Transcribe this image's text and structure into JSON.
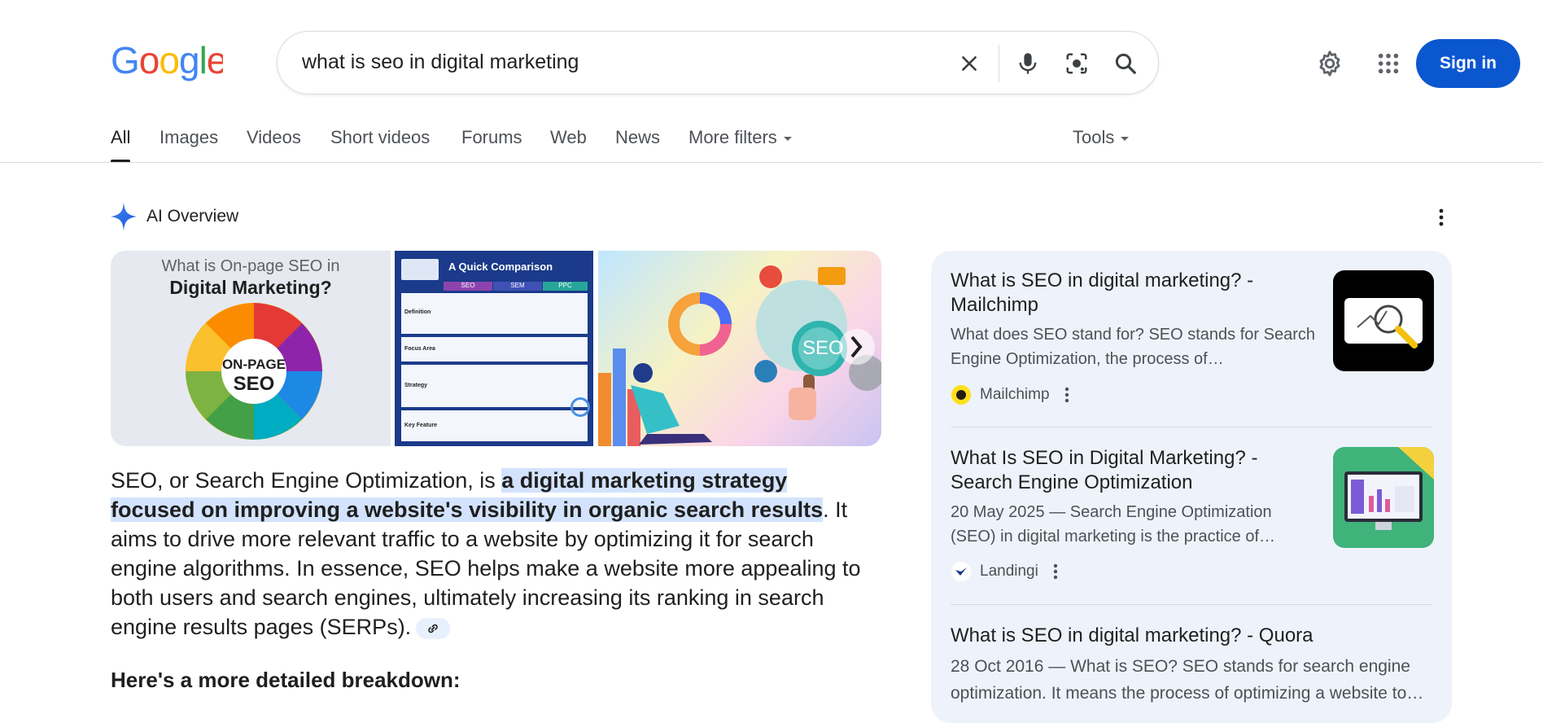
{
  "search": {
    "query": "what is seo in digital marketing"
  },
  "header": {
    "sign_in_label": "Sign in"
  },
  "tabs": [
    "All",
    "Images",
    "Videos",
    "Short videos",
    "Forums",
    "Web",
    "News",
    "More filters"
  ],
  "tools_label": "Tools",
  "ai_overview": {
    "title": "AI Overview",
    "images": {
      "img1_line1": "What is On-page SEO in",
      "img1_line2": "Digital Marketing?",
      "img1_center_1": "ON-PAGE",
      "img1_center_2": "SEO",
      "img2_title": "A Quick Comparison",
      "img2_cols": [
        "SEO",
        "SEM",
        "PPC"
      ],
      "img2_rows": [
        "Definition",
        "Focus Area",
        "Strategy",
        "Key Feature"
      ],
      "img3_label": "SEO"
    },
    "text_pre": "SEO, or Search Engine Optimization, is ",
    "text_highlight": "a digital marketing strategy focused on improving a website's visibility in organic search results",
    "text_post": ". It aims to drive more relevant traffic to a website by optimizing it for search engine algorithms. In essence, SEO helps make a website more appealing to both users and search engines, ultimately increasing its ranking in search engine results pages (SERPs).",
    "breakdown_heading": "Here's a more detailed breakdown:"
  },
  "sources": [
    {
      "title": "What is SEO in digital marketing? - Mailchimp",
      "snippet": "What does SEO stand for? SEO stands for Search Engine Optimization, the process of…",
      "source": "Mailchimp"
    },
    {
      "title": "What Is SEO in Digital Marketing? - Search Engine Optimization",
      "snippet": "20 May 2025 — Search Engine Optimization (SEO) in digital marketing is the practice of…",
      "source": "Landingi"
    },
    {
      "title": "What is SEO in digital marketing? - Quora",
      "snippet": "28 Oct 2016 — What is SEO? SEO stands for search engine optimization. It means the process of optimizing a website to…"
    }
  ],
  "colors": {
    "google_blue": "#4285F4",
    "google_red": "#EA4335",
    "google_yellow": "#FBBC05",
    "google_green": "#34A853",
    "signin_bg": "#0b57d0",
    "highlight": "#d3e3fd",
    "panel_bg": "#eef3fb"
  },
  "icons": [
    "clear-icon",
    "mic-icon",
    "lens-icon",
    "search-icon",
    "gear-icon",
    "apps-icon",
    "ai-sparkle-icon",
    "more-vert-icon",
    "link-icon"
  ]
}
